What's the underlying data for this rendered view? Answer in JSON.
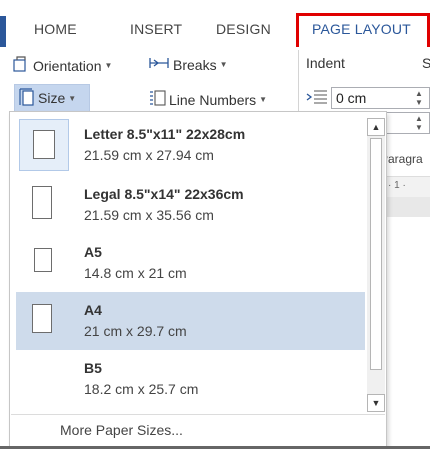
{
  "ribbon": {
    "tabs": [
      {
        "label": "HOME"
      },
      {
        "label": "INSERT"
      },
      {
        "label": "DESIGN"
      },
      {
        "label": "PAGE LAYOUT"
      }
    ],
    "accent_color": "#2b579a",
    "highlight_color": "#e00000"
  },
  "page_setup": {
    "orientation_label": "Orientation",
    "breaks_label": "Breaks",
    "size_label": "Size",
    "line_numbers_label": "Line Numbers"
  },
  "paragraph": {
    "indent_label": "Indent",
    "indent_left_value": "0 cm",
    "group_label": "Paragra",
    "ruler_text": "· 1 ·",
    "partial_label": "S"
  },
  "size_menu": {
    "items": [
      {
        "name": "Letter 8.5\"x11\" 22x28cm",
        "dims": "21.59 cm x 27.94 cm",
        "selected": false
      },
      {
        "name": "Legal 8.5\"x14\" 22x36cm",
        "dims": "21.59 cm x 35.56 cm",
        "selected": false
      },
      {
        "name": "A5",
        "dims": "14.8 cm x 21 cm",
        "selected": false
      },
      {
        "name": "A4",
        "dims": "21 cm x 29.7 cm",
        "selected": true
      },
      {
        "name": "B5",
        "dims": "18.2 cm x 25.7 cm",
        "selected": false
      }
    ],
    "more_label": "More Paper Sizes...",
    "selection_color": "#cedbeb"
  }
}
